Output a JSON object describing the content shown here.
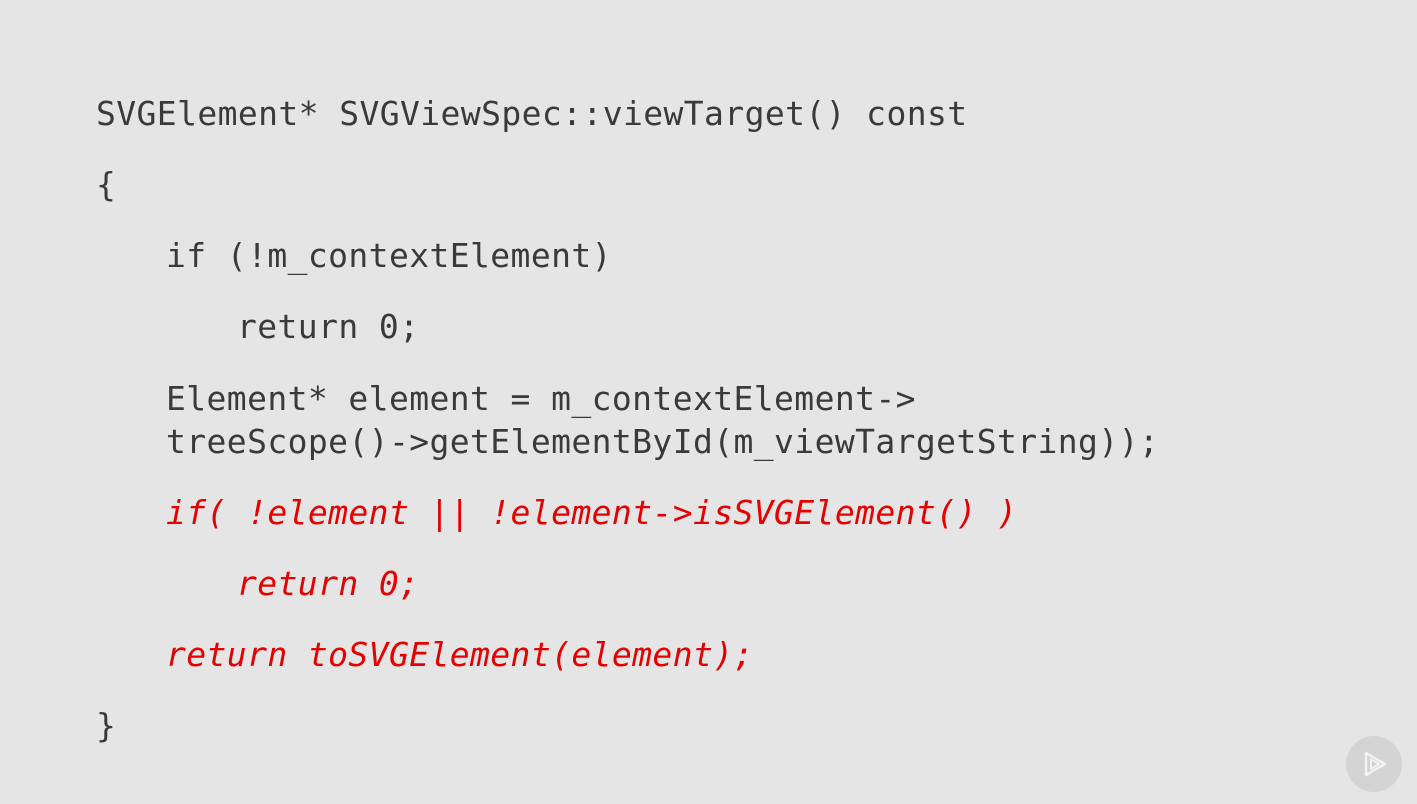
{
  "code": {
    "lines": [
      "SVGElement* SVGViewSpec::viewTarget() const",
      "{",
      "if (!m_contextElement)",
      "return 0;",
      "Element* element = m_contextElement->",
      "treeScope()->getElementById(m_viewTargetString));",
      "if( !element || !element->isSVGElement() )",
      "return 0;",
      "return toSVGElement(element);",
      "}"
    ],
    "highlight_color": "#e60000",
    "text_color": "#3a3a3a",
    "background_color": "#e6e5e5"
  },
  "logo": {
    "icon": "play-logo-icon"
  }
}
